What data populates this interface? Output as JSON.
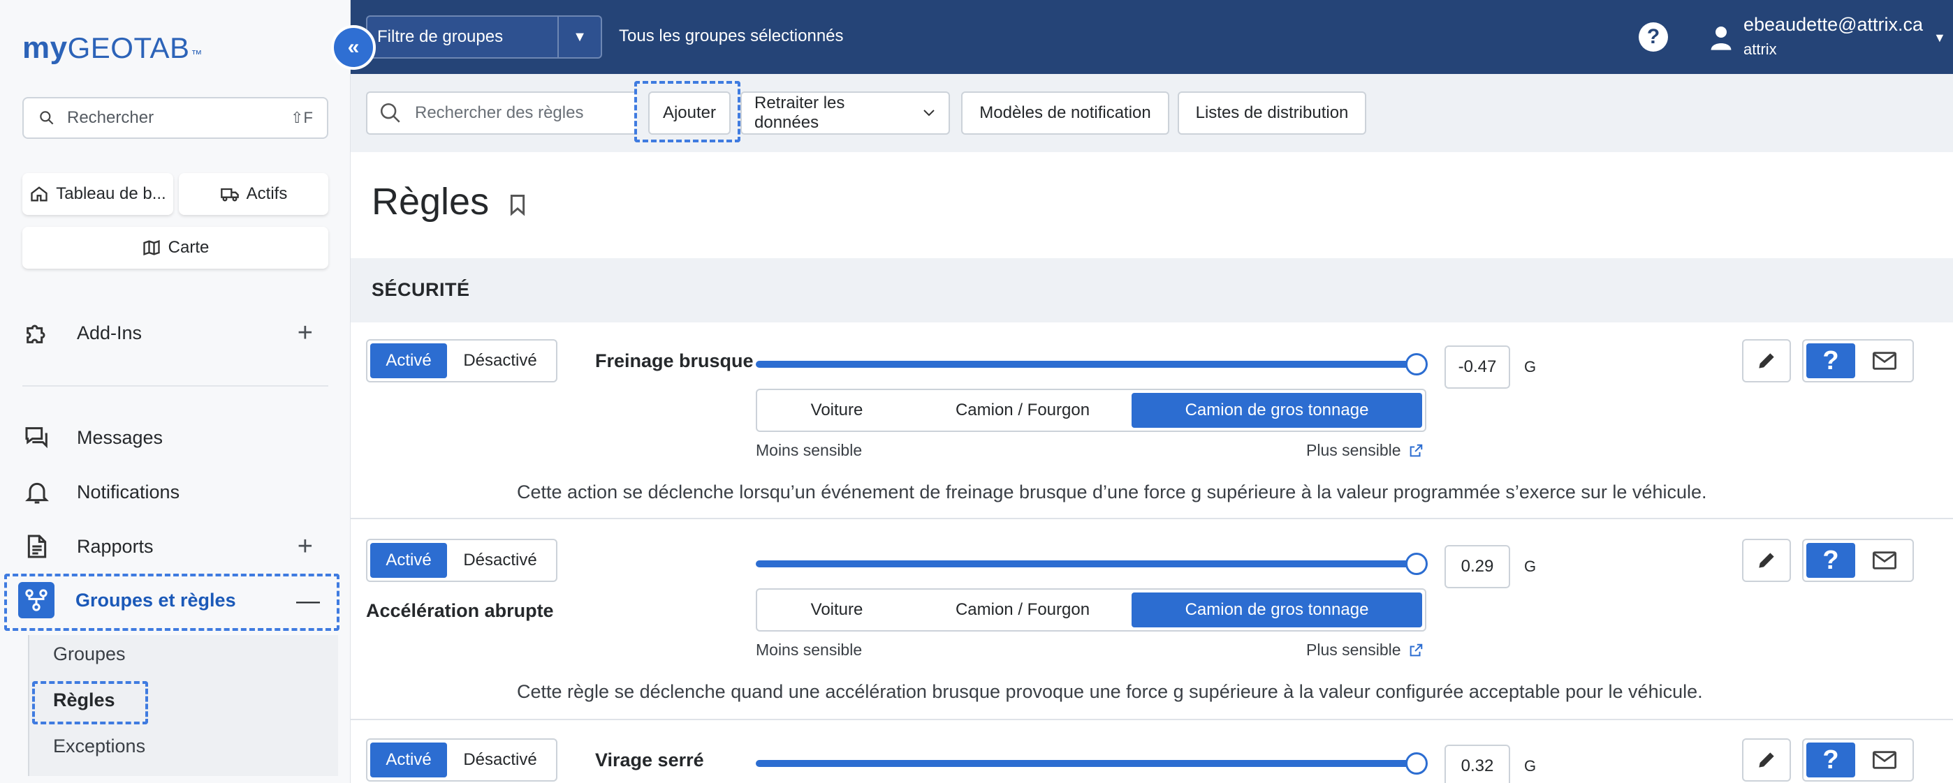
{
  "app": {
    "logo_my": "my",
    "logo_geotab": "GEOTAB",
    "logo_tm": "™"
  },
  "sidebar": {
    "search_placeholder": "Rechercher",
    "search_shortcut": "⇧F",
    "quick": {
      "dashboard": "Tableau de b...",
      "assets": "Actifs",
      "map": "Carte"
    },
    "items": {
      "addins": "Add-Ins",
      "messages": "Messages",
      "notifications": "Notifications",
      "reports": "Rapports",
      "groups_rules": "Groupes et règles"
    },
    "sub": {
      "groups": "Groupes",
      "rules": "Règles",
      "exceptions": "Exceptions"
    }
  },
  "topbar": {
    "group_filter": "Filtre de groupes",
    "group_status": "Tous les groupes sélectionnés",
    "help": "?",
    "user_email": "ebeaudette@attrix.ca",
    "user_org": "attrix"
  },
  "toolbar": {
    "search_placeholder": "Rechercher des règles",
    "add": "Ajouter",
    "reprocess": "Retraiter les données",
    "templates": "Modèles de notification",
    "distribution": "Listes de distribution"
  },
  "page": {
    "title": "Règles",
    "section": "SÉCURITÉ"
  },
  "common": {
    "on": "Activé",
    "off": "Désactivé",
    "vehicle_car": "Voiture",
    "vehicle_truck": "Camion / Fourgon",
    "vehicle_heavy": "Camion de gros tonnage",
    "less_sensitive": "Moins sensible",
    "more_sensitive": "Plus sensible",
    "unit": "G"
  },
  "rules": [
    {
      "name": "Freinage brusque",
      "value": "-0.47",
      "level": 1.0,
      "description": "Cette action se déclenche lorsqu’un événement de freinage brusque d’une force g supérieure à la valeur programmée s’exerce sur le véhicule."
    },
    {
      "name": "Accélération abrupte",
      "value": "0.29",
      "level": 1.0,
      "description": "Cette règle se déclenche quand une accélération brusque provoque une force g supérieure à la valeur configurée acceptable pour le véhicule."
    },
    {
      "name": "Virage serré",
      "value": "0.32",
      "level": 1.0
    }
  ],
  "colors": {
    "accent": "#2c6dd1",
    "topbar": "#254477",
    "highlight": "#3f7be0"
  }
}
